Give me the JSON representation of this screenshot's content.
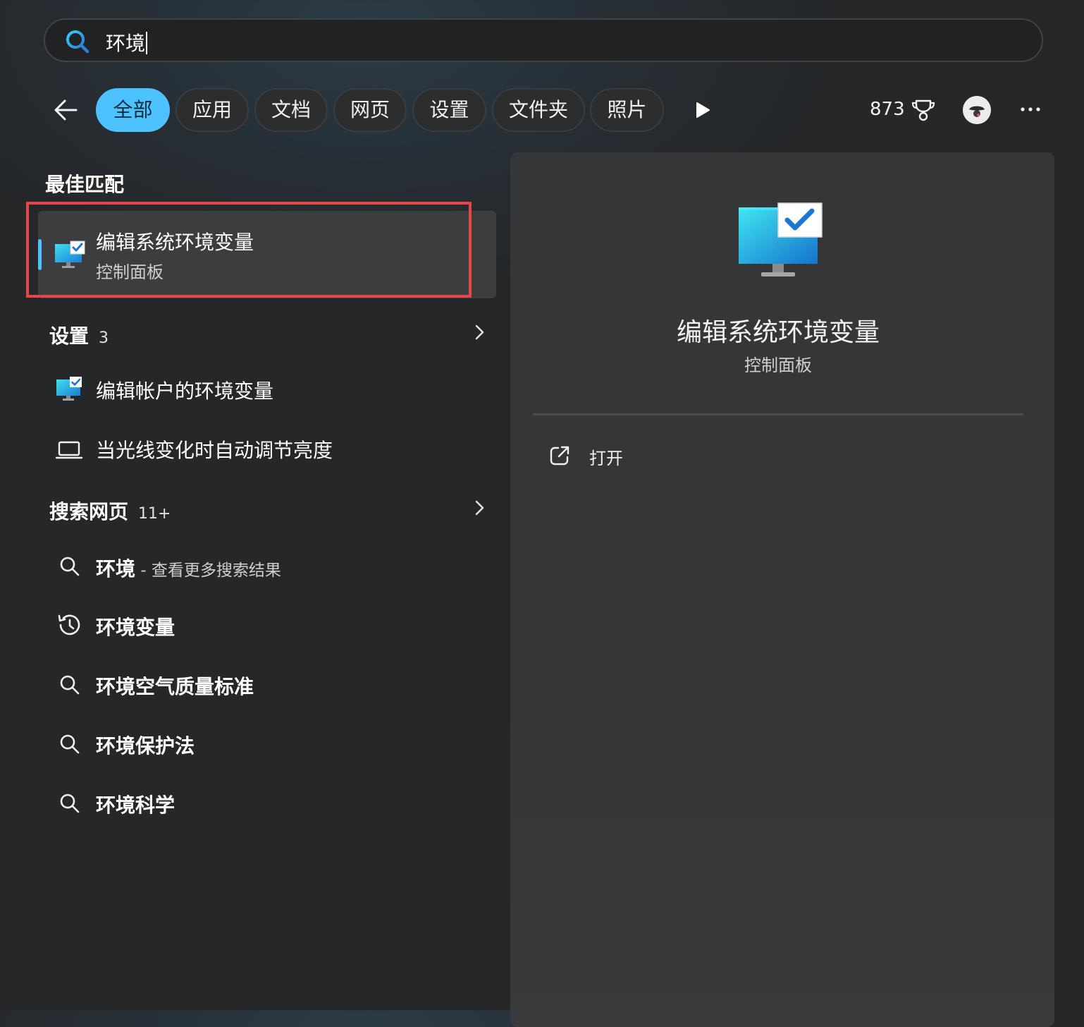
{
  "search": {
    "query": "环境"
  },
  "filters": [
    "全部",
    "应用",
    "文档",
    "网页",
    "设置",
    "文件夹",
    "照片"
  ],
  "header": {
    "points": "873"
  },
  "best_match": {
    "section_title": "最佳匹配",
    "title": "编辑系统环境变量",
    "subtitle": "控制面板"
  },
  "settings_section": {
    "title": "设置",
    "count": "3",
    "items": [
      {
        "label": "编辑帐户的环境变量",
        "icon": "control-panel-icon"
      },
      {
        "label": "当光线变化时自动调节亮度",
        "icon": "laptop-icon"
      }
    ]
  },
  "web_section": {
    "title": "搜索网页",
    "count": "11+",
    "items": [
      {
        "label": "环境",
        "suffix": " - 查看更多搜索结果",
        "icon": "search-icon"
      },
      {
        "label": "环境变量",
        "icon": "history-icon"
      },
      {
        "label": "环境空气质量标准",
        "icon": "search-icon"
      },
      {
        "label": "环境保护法",
        "icon": "search-icon"
      },
      {
        "label": "环境科学",
        "icon": "search-icon"
      }
    ]
  },
  "preview": {
    "title": "编辑系统环境变量",
    "subtitle": "控制面板",
    "action_label": "打开"
  },
  "colors": {
    "accent": "#4cc2ff",
    "highlight": "#e84549"
  }
}
